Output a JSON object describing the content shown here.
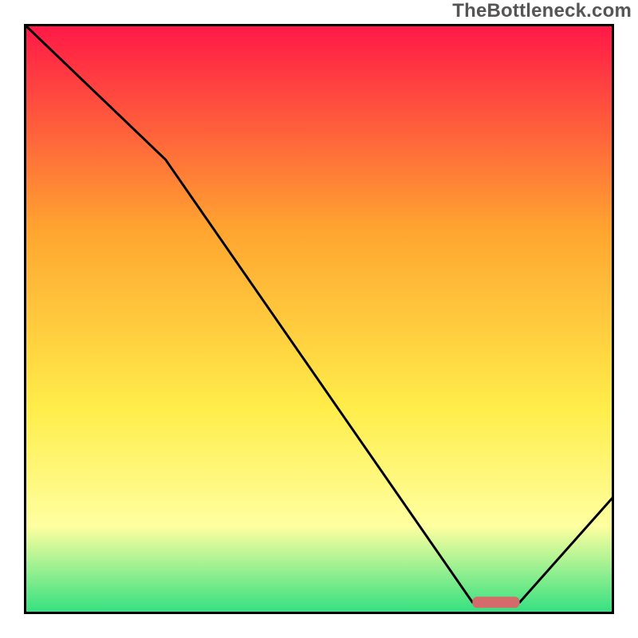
{
  "attribution": "TheBottleneck.com",
  "colors": {
    "red": "#ff1747",
    "orange": "#ffa530",
    "yellow": "#ffed4a",
    "lightyellow": "#ffffa0",
    "green": "#30e080",
    "curve": "#000000",
    "border": "#000000",
    "marker": "#d46a6a"
  },
  "chart_data": {
    "type": "line",
    "title": "",
    "xlabel": "",
    "ylabel": "",
    "xlim": [
      0,
      100
    ],
    "ylim": [
      0,
      100
    ],
    "grid": false,
    "legend": false,
    "x": [
      0,
      24,
      76,
      84,
      100
    ],
    "values": [
      100,
      77,
      2,
      2,
      20
    ],
    "marker": {
      "x_start": 76,
      "x_end": 84,
      "y": 2
    },
    "notes": "Curve descends from top-left with a slight kink near x≈24, reaches a flat minimum around x≈76–84 (highlighted by marker), then rises toward the right edge. Background is a vertical red→orange→yellow→green gradient implying a heatmap-style score backdrop; axes have no ticks or labels."
  }
}
